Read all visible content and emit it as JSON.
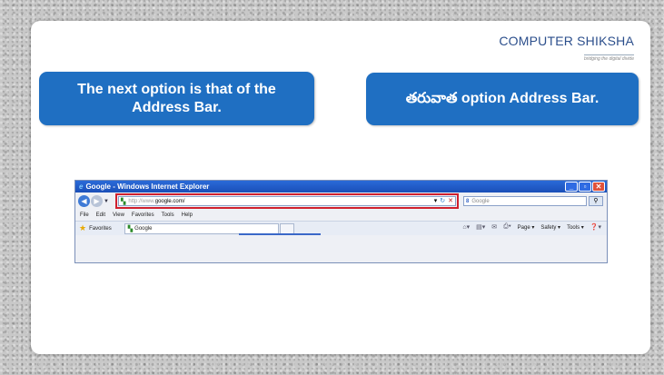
{
  "logo": {
    "brand_main": "COMPUTER",
    "brand_second": " SHIKSHA",
    "tagline": "bridging the digital divide"
  },
  "callouts": {
    "left_text": "The next option is that of the Address Bar.",
    "right_text": "తరువాత option Address Bar."
  },
  "browser": {
    "window_title": "Google - Windows Internet Explorer",
    "address": {
      "protocol": "http://www.",
      "host": "google.com/"
    },
    "search_placeholder": "Google",
    "search_provider_glyph": "8",
    "menu": [
      "File",
      "Edit",
      "View",
      "Favorites",
      "Tools",
      "Help"
    ],
    "favorites_label": "Favorites",
    "tab_title": "Google",
    "command_bar": [
      "Page ▾",
      "Safety ▾",
      "Tools ▾"
    ]
  },
  "colors": {
    "callout_bg": "#1f6fc2",
    "highlight_border": "#d0202e"
  }
}
